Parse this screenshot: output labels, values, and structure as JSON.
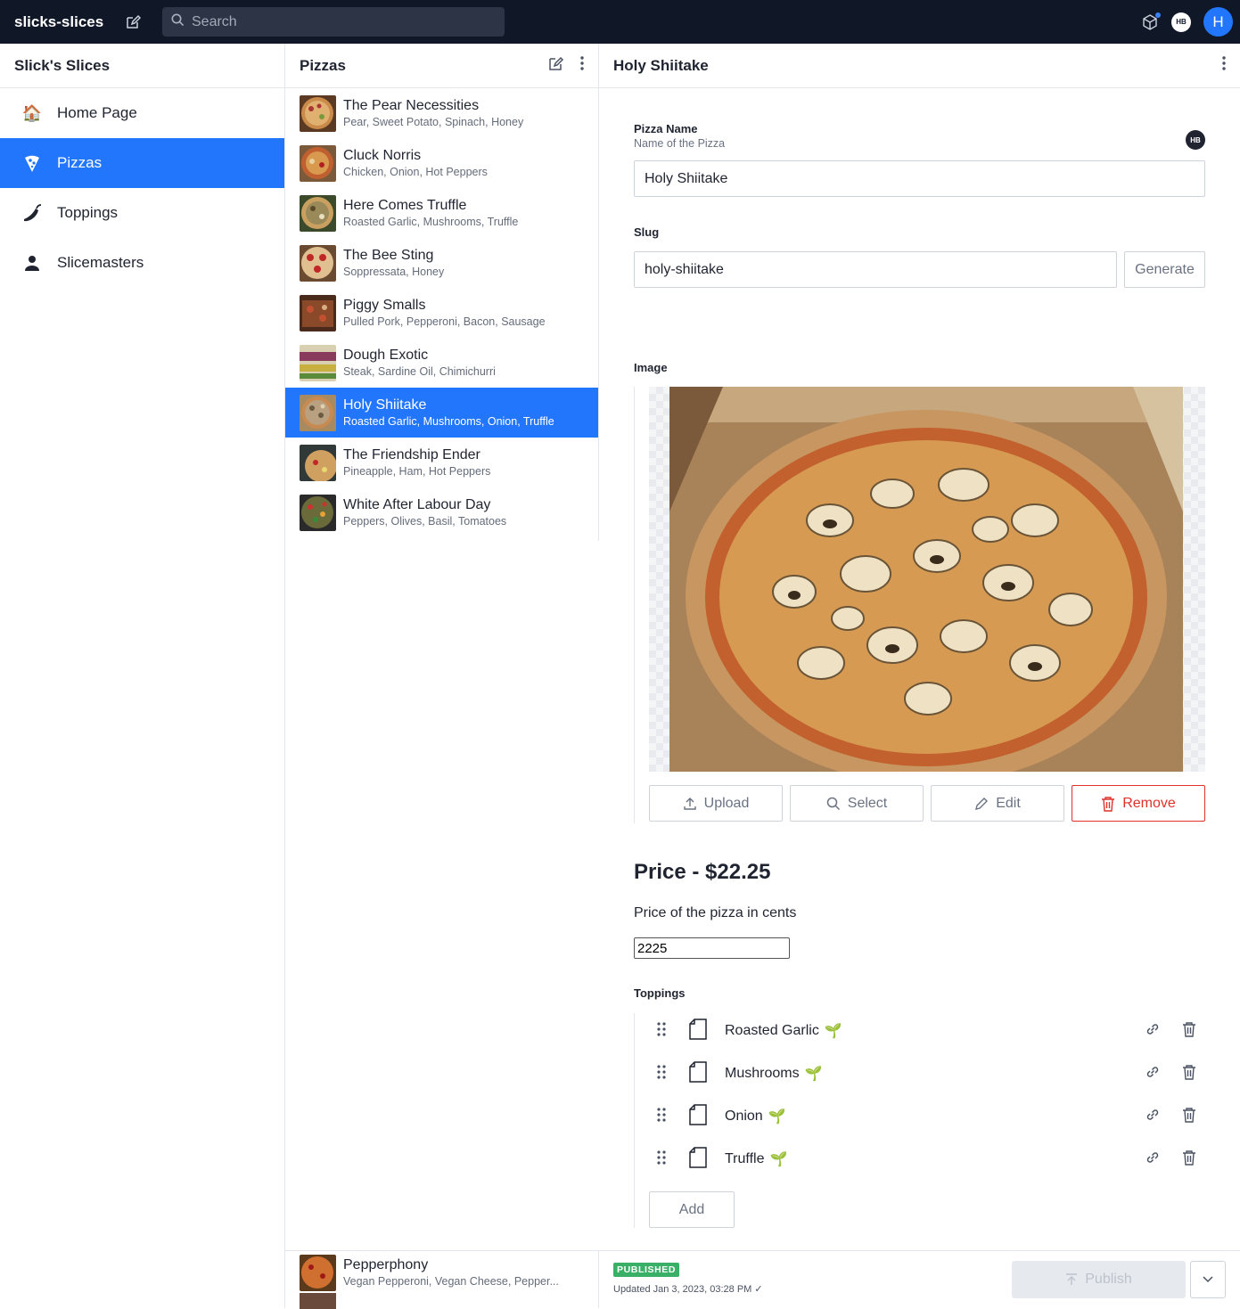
{
  "topbar": {
    "brand": "slicks-slices",
    "search_placeholder": "Search",
    "user_badge": "HB",
    "avatar_initial": "H"
  },
  "structure": {
    "title": "Slick's Slices",
    "items": [
      {
        "label": "Home Page",
        "icon": "house-emoji-icon"
      },
      {
        "label": "Pizzas",
        "icon": "pizza-icon",
        "active": true
      },
      {
        "label": "Toppings",
        "icon": "pepper-icon"
      },
      {
        "label": "Slicemasters",
        "icon": "person-icon"
      }
    ]
  },
  "pizzas_pane": {
    "title": "Pizzas",
    "items": [
      {
        "name": "The Pear Necessities",
        "toppings": "Pear, Sweet Potato, Spinach, Honey"
      },
      {
        "name": "Cluck Norris",
        "toppings": "Chicken, Onion, Hot Peppers"
      },
      {
        "name": "Here Comes Truffle",
        "toppings": "Roasted Garlic, Mushrooms, Truffle"
      },
      {
        "name": "The Bee Sting",
        "toppings": "Soppressata, Honey"
      },
      {
        "name": "Piggy Smalls",
        "toppings": "Pulled Pork, Pepperoni, Bacon, Sausage"
      },
      {
        "name": "Dough Exotic",
        "toppings": "Steak, Sardine Oil, Chimichurri"
      },
      {
        "name": "Holy Shiitake",
        "toppings": "Roasted Garlic, Mushrooms, Onion, Truffle",
        "active": true
      },
      {
        "name": "The Friendship Ender",
        "toppings": "Pineapple, Ham, Hot Peppers"
      },
      {
        "name": "White After Labour Day",
        "toppings": "Peppers, Olives, Basil, Tomatoes"
      }
    ],
    "bottom_item": {
      "name": "Pepperphony",
      "toppings": "Vegan Pepperoni, Vegan Cheese, Pepper..."
    }
  },
  "document": {
    "title": "Holy Shiitake",
    "name_field": {
      "label": "Pizza Name",
      "description": "Name of the Pizza",
      "value": "Holy Shiitake",
      "presence": "HB"
    },
    "slug_field": {
      "label": "Slug",
      "value": "holy-shiitake",
      "generate_label": "Generate"
    },
    "image_field": {
      "label": "Image",
      "upload": "Upload",
      "select": "Select",
      "edit": "Edit",
      "remove": "Remove"
    },
    "price": {
      "title": "Price - $22.25",
      "description": "Price of the pizza in cents",
      "value": "2225"
    },
    "toppings": {
      "label": "Toppings",
      "items": [
        "Roasted Garlic",
        "Mushrooms",
        "Onion",
        "Truffle"
      ],
      "add_label": "Add"
    }
  },
  "footer": {
    "status": "PUBLISHED",
    "updated": "Updated Jan 3, 2023, 03:28 PM",
    "publish_label": "Publish"
  },
  "colors": {
    "topbar": "#101828",
    "accent": "#2276fc",
    "danger": "#e0312b",
    "published": "#3ab066"
  }
}
